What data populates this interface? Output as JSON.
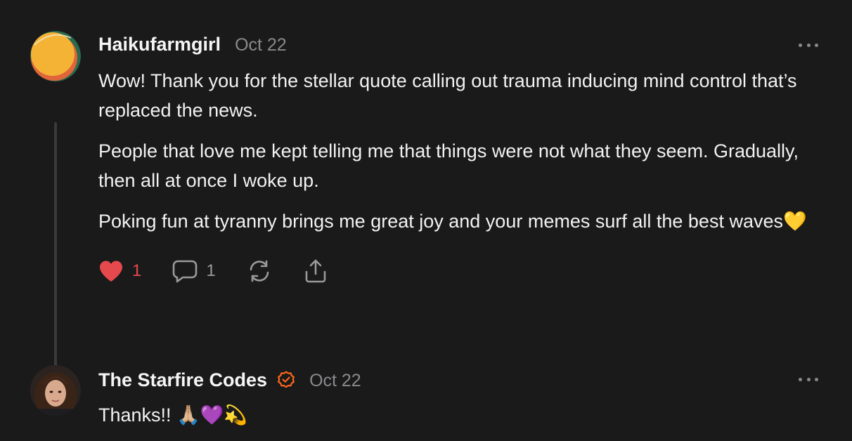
{
  "comments": [
    {
      "author": "Haikufarmgirl",
      "date": "Oct 22",
      "paragraphs": [
        "Wow! Thank you for the stellar quote calling out trauma inducing mind control that’s replaced the news.",
        "People that love me kept telling me that things were not what they seem. Gradually, then all at once I woke up.",
        "Poking fun at tyranny brings me great joy and your memes surf all the best waves💛"
      ],
      "likes": "1",
      "replies": "1",
      "icons": [
        "heart-icon",
        "comment-icon",
        "restack-icon",
        "share-icon",
        "more-icon"
      ]
    },
    {
      "author": "The Starfire Codes",
      "date": "Oct 22",
      "paragraphs": [
        "Thanks!! 🙏🏼💜💫"
      ],
      "verified": true,
      "icons": [
        "verified-icon",
        "more-icon"
      ]
    }
  ],
  "colors": {
    "background": "#1a1a1b",
    "text": "#f2f2f2",
    "muted": "#8a8a8d",
    "like": "#e5484d",
    "verified": "#ff6719"
  }
}
